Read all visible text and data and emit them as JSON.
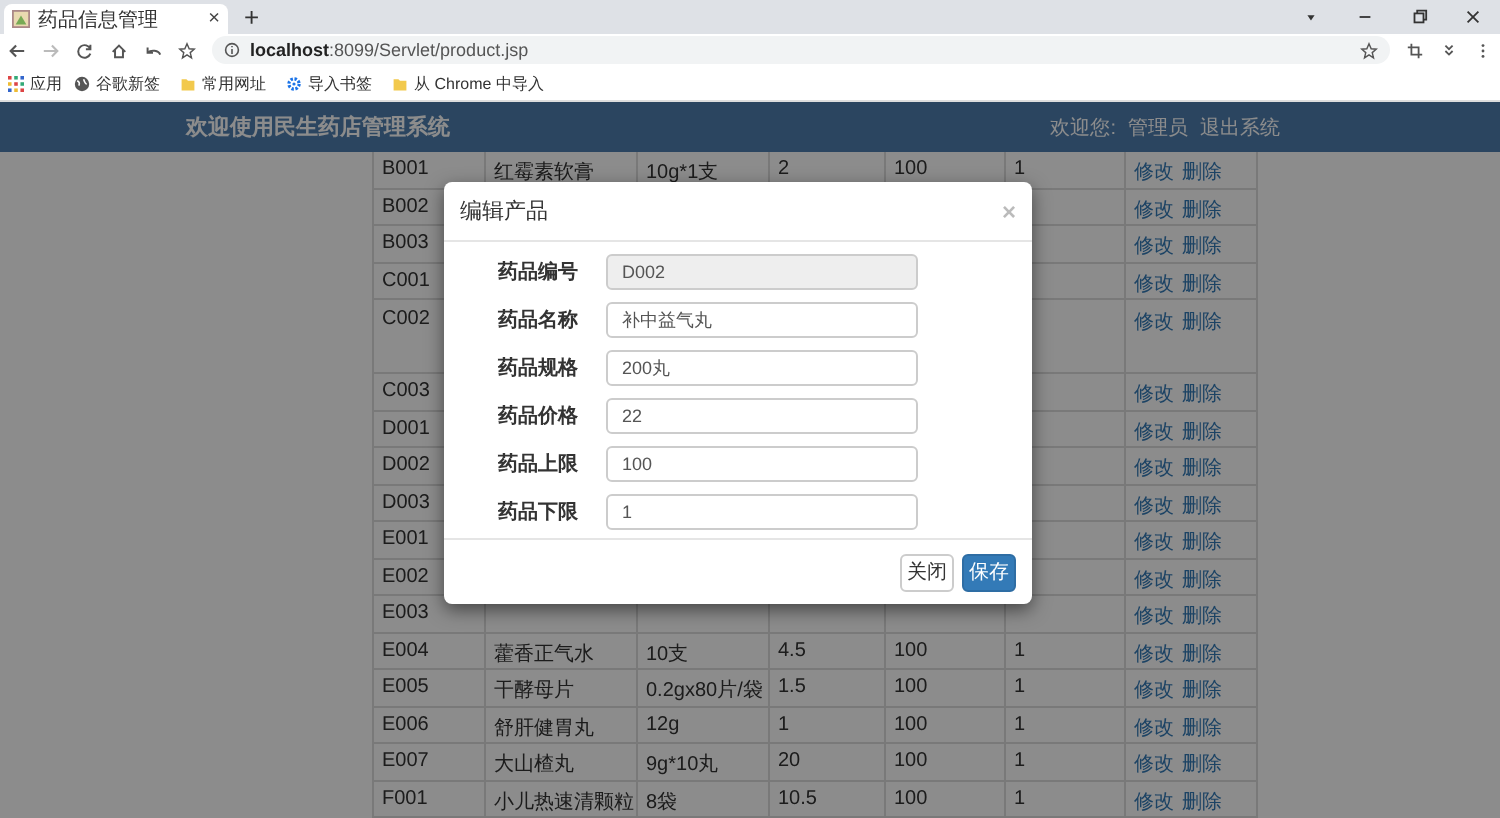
{
  "browser": {
    "tab_title": "药品信息管理",
    "tab_close": "×",
    "new_tab": "+",
    "url_host": "localhost",
    "url_path": ":8099/Servlet/product.jsp",
    "bookmarks": [
      {
        "label": "应用",
        "kind": "apps"
      },
      {
        "label": "谷歌新签",
        "kind": "globe"
      },
      {
        "label": "常用网址",
        "kind": "folder"
      },
      {
        "label": "导入书签",
        "kind": "gear"
      },
      {
        "label": "从 Chrome 中导入",
        "kind": "folder"
      }
    ]
  },
  "header": {
    "title": "欢迎使用民生药店管理系统",
    "welcome": "欢迎您:",
    "user": "管理员",
    "logout": "退出系统"
  },
  "table": {
    "rows": [
      {
        "cells": [
          "B001",
          "红霉素软膏",
          "10g*1支",
          "2",
          "100",
          "1"
        ],
        "actions": [
          "修改",
          "删除"
        ],
        "wrapped": false
      },
      {
        "cells": [
          "B002"
        ],
        "actions": [
          "修改",
          "删除"
        ],
        "wrapped": false
      },
      {
        "cells": [
          "B003"
        ],
        "actions": [
          "修改",
          "删除"
        ],
        "wrapped": false
      },
      {
        "cells": [
          "C001"
        ],
        "actions": [
          "修改",
          "删除"
        ],
        "wrapped": false
      },
      {
        "cells": [
          "C002"
        ],
        "actions": [
          "修改",
          "删除"
        ],
        "wrapped": true
      },
      {
        "cells": [
          "C003"
        ],
        "actions": [
          "修改",
          "删除"
        ],
        "wrapped": false
      },
      {
        "cells": [
          "D001"
        ],
        "actions": [
          "修改",
          "删除"
        ],
        "wrapped": false
      },
      {
        "cells": [
          "D002"
        ],
        "actions": [
          "修改",
          "删除"
        ],
        "wrapped": false
      },
      {
        "cells": [
          "D003"
        ],
        "actions": [
          "修改",
          "删除"
        ],
        "wrapped": false
      },
      {
        "cells": [
          "E001"
        ],
        "actions": [
          "修改",
          "删除"
        ],
        "wrapped": false
      },
      {
        "cells": [
          "E002"
        ],
        "actions": [
          "修改",
          "删除"
        ],
        "wrapped": false
      },
      {
        "cells": [
          "E003"
        ],
        "actions": [
          "修改",
          "删除"
        ],
        "wrapped": false
      },
      {
        "cells": [
          "E004",
          "藿香正气水",
          "10支",
          "4.5",
          "100",
          "1"
        ],
        "actions": [
          "修改",
          "删除"
        ],
        "wrapped": false
      },
      {
        "cells": [
          "E005",
          "干酵母片",
          "0.2gx80片/袋",
          "1.5",
          "100",
          "1"
        ],
        "actions": [
          "修改",
          "删除"
        ],
        "wrapped": false
      },
      {
        "cells": [
          "E006",
          "舒肝健胃丸",
          "12g",
          "1",
          "100",
          "1"
        ],
        "actions": [
          "修改",
          "删除"
        ],
        "wrapped": false
      },
      {
        "cells": [
          "E007",
          "大山楂丸",
          "9g*10丸",
          "20",
          "100",
          "1"
        ],
        "actions": [
          "修改",
          "删除"
        ],
        "wrapped": false
      },
      {
        "cells": [
          "F001",
          "小儿热速清颗粒",
          "8袋",
          "10.5",
          "100",
          "1"
        ],
        "actions": [
          "修改",
          "删除"
        ],
        "wrapped": false
      }
    ]
  },
  "modal": {
    "title": "编辑产品",
    "close": "×",
    "fields": [
      {
        "label": "药品编号",
        "value": "D002",
        "disabled": true
      },
      {
        "label": "药品名称",
        "value": "补中益气丸",
        "disabled": false
      },
      {
        "label": "药品规格",
        "value": "200丸",
        "disabled": false
      },
      {
        "label": "药品价格",
        "value": "22",
        "disabled": false
      },
      {
        "label": "药品上限",
        "value": "100",
        "disabled": false
      },
      {
        "label": "药品下限",
        "value": "1",
        "disabled": false
      }
    ],
    "buttons": [
      {
        "label": "关闭",
        "kind": "default"
      },
      {
        "label": "保存",
        "kind": "primary"
      }
    ]
  }
}
